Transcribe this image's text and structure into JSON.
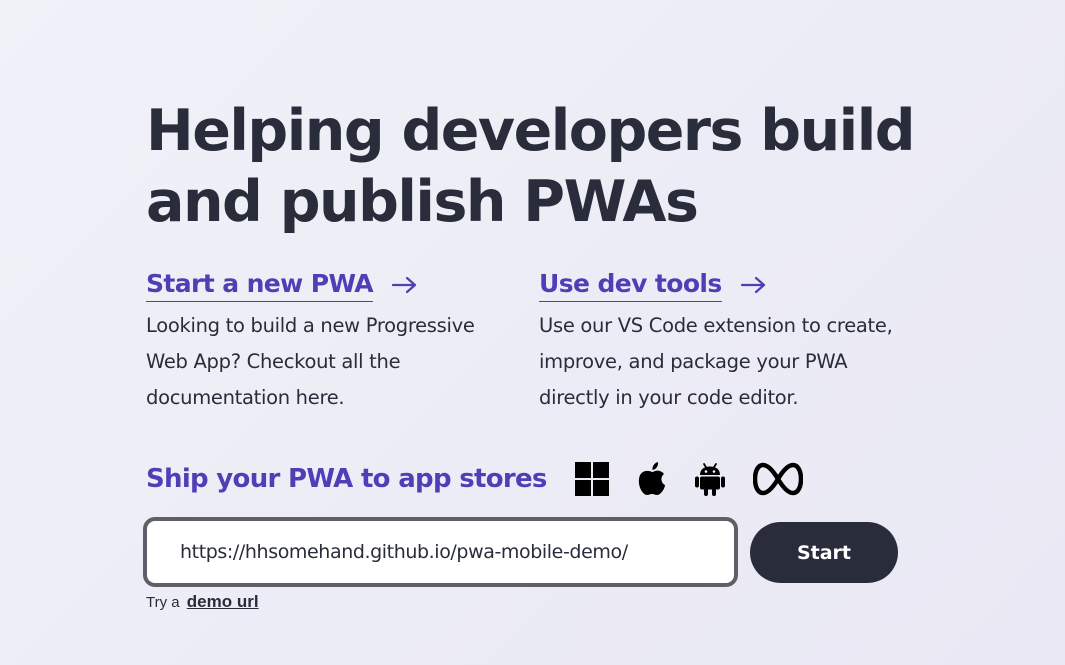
{
  "hero": {
    "title": "Helping developers build and publish PWAs"
  },
  "features": [
    {
      "link_label": "Start a new PWA",
      "arrow_icon": "arrow-right-icon",
      "description": "Looking to build a new Progressive Web App? Checkout all the documentation here."
    },
    {
      "link_label": "Use dev tools",
      "arrow_icon": "arrow-right-icon",
      "description": "Use our VS Code extension to create, improve, and package your PWA directly in your code editor."
    }
  ],
  "stores": {
    "title": "Ship your PWA to app stores",
    "icons": [
      "windows-icon",
      "apple-icon",
      "android-icon",
      "meta-icon"
    ]
  },
  "url_form": {
    "value": "https://hhsomehand.github.io/pwa-mobile-demo/",
    "start_label": "Start"
  },
  "demo": {
    "prefix": "Try a",
    "link_label": "demo url"
  },
  "colors": {
    "accent": "#4f3fb6",
    "dark": "#292c3a",
    "input_border": "#5e5f68"
  }
}
